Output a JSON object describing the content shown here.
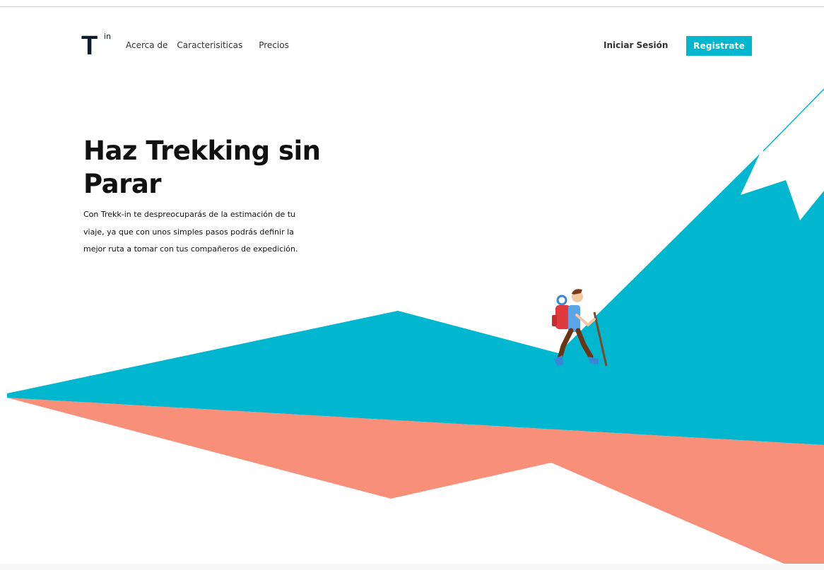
{
  "brand": {
    "logo_letter": "T",
    "logo_sup": "in"
  },
  "nav": {
    "items": [
      {
        "label": "Acerca de"
      },
      {
        "label": "Caracterisiticas"
      },
      {
        "label": "Precios"
      }
    ],
    "login_label": "Iniciar Sesión",
    "register_label": "Registrate"
  },
  "hero": {
    "title": "Haz Trekking sin Parar",
    "description": "Con Trekk-in te despreocuparás de la estimación de tu viaje, ya que con unos simples pasos podrás definir la mejor ruta a tomar con tus compañeros de expedición."
  },
  "colors": {
    "accent": "#00b7cf",
    "mountain": "#00b7cf",
    "terrain_shadow": "#f78f79",
    "snow": "#ffffff",
    "text_dark": "#111111",
    "logo": "#0d1b2a"
  },
  "illustration": {
    "subject": "hiker-with-backpack-and-walking-stick"
  }
}
